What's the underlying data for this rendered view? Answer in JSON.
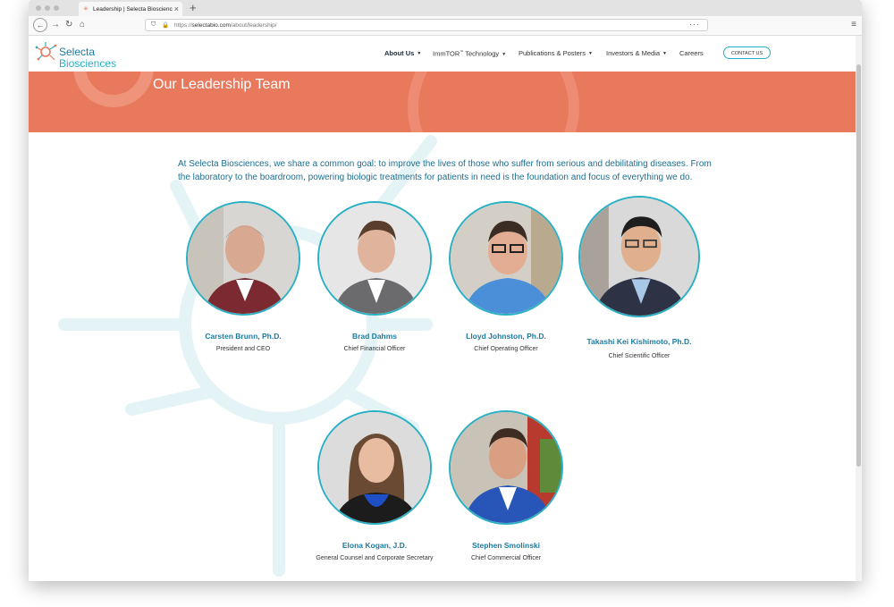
{
  "browser": {
    "tab_title": "Leadership | Selecta Bioscienc",
    "tab_favicon": "selecta-logo-icon",
    "url_scheme": "https://",
    "url_domain": "selectabio.com",
    "url_path": "/about/leadership/"
  },
  "site": {
    "logo_line1": "Selecta",
    "logo_line2": "Biosciences",
    "nav": [
      {
        "label": "About Us",
        "caret": "▼"
      },
      {
        "label": "ImmTOR",
        "sup": "™",
        "rest": " Technology",
        "caret": "▼"
      },
      {
        "label": "Publications & Posters",
        "caret": "▼"
      },
      {
        "label": "Investors & Media",
        "caret": "▼"
      },
      {
        "label": "Careers"
      }
    ],
    "contact_label": "CONTACT US"
  },
  "hero": {
    "title": "Our Leadership Team"
  },
  "intro": "At Selecta Biosciences, we share a common goal: to improve the lives of those who suffer from serious and debilitating diseases. From the laboratory to the boardroom, powering biologic treatments for patients in need is the foundation and focus of everything we do.",
  "team": [
    {
      "name": "Carsten Brunn, Ph.D.",
      "role": "President and CEO"
    },
    {
      "name": "Brad Dahms",
      "role": "Chief Financial Officer"
    },
    {
      "name": "Lloyd Johnston, Ph.D.",
      "role": "Chief Operating Officer"
    },
    {
      "name": "Takashi Kei Kishimoto, Ph.D.",
      "role": "Chief Scientific Officer"
    },
    {
      "name": "Elona Kogan, J.D.",
      "role": "General Counsel and Corporate Secretary"
    },
    {
      "name": "Stephen Smolinski",
      "role": "Chief Commercial Officer"
    }
  ],
  "colors": {
    "hero_bg": "#e8795d",
    "accent_teal": "#2ab0c4",
    "text_blue": "#1d7ba0"
  }
}
